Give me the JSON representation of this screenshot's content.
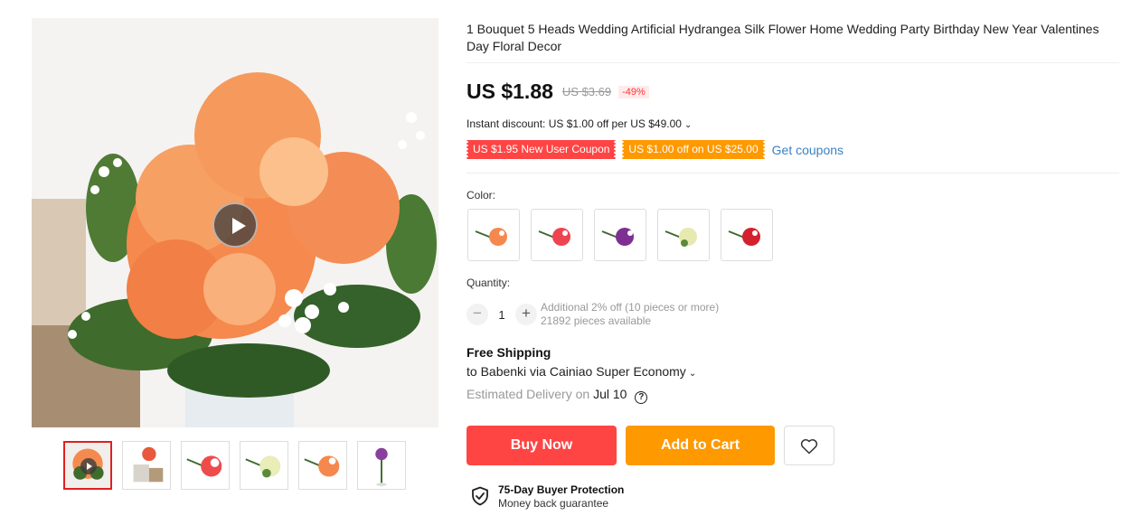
{
  "product": {
    "title": "1 Bouquet 5 Heads Wedding Artificial Hydrangea Silk Flower Home Wedding Party Birthday New Year Valentines Day Floral Decor"
  },
  "price": {
    "current": "US $1.88",
    "original": "US $3.69",
    "discount": "-49%"
  },
  "instant_discount": "Instant discount: US $1.00 off per US $49.00",
  "coupons": [
    {
      "label": "US $1.95 New User Coupon",
      "color": "#ff4747"
    },
    {
      "label": "US $1.00 off on US $25.00",
      "color": "#ff9900"
    }
  ],
  "get_coupons": "Get coupons",
  "color_label": "Color:",
  "color_options": [
    "orange",
    "red",
    "purple",
    "cream",
    "crimson"
  ],
  "quantity": {
    "label": "Quantity:",
    "minus": "−",
    "plus": "+",
    "value": "1",
    "note": "Additional 2% off (10 pieces or more)",
    "available": "21892 pieces available"
  },
  "shipping": {
    "title": "Free Shipping",
    "route": "to Babenki via Cainiao Super Economy",
    "estimated_label": "Estimated Delivery on",
    "date": "Jul 10",
    "help": "?"
  },
  "actions": {
    "buy_now": "Buy Now",
    "add_to_cart": "Add to Cart",
    "wishlist_icon": "heart-icon"
  },
  "protection": {
    "title": "75-Day Buyer Protection",
    "subtitle": "Money back guarantee",
    "icon": "shield-check-icon"
  },
  "gallery": {
    "thumbnails": [
      "video-orange-bouquet",
      "bouquet-in-vase",
      "red-bouquet",
      "cream-bouquet",
      "orange-bouquet",
      "purple-stem"
    ],
    "active_index": 0
  },
  "accent_colors": {
    "buy": "#ff4747",
    "cart": "#ff9900",
    "link": "#3b82c4"
  }
}
